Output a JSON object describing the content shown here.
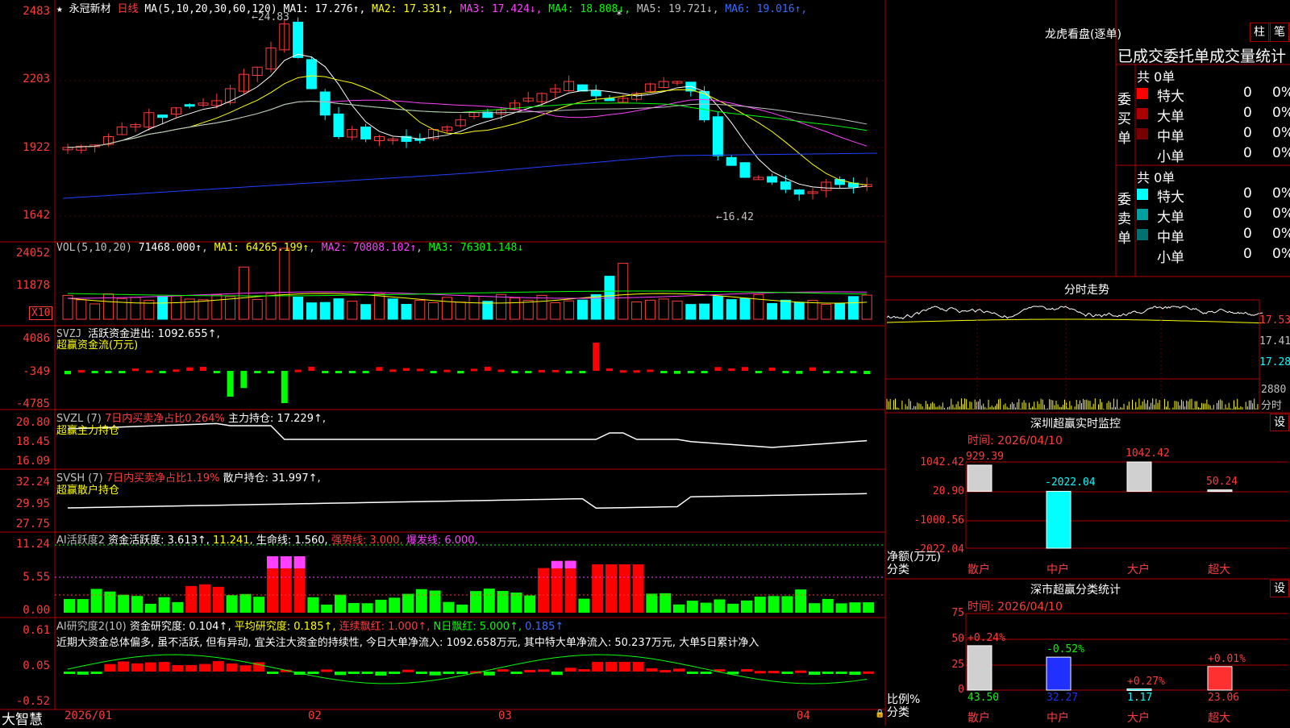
{
  "kline": {
    "star": "★",
    "stock_name": "永冠新材",
    "period": "日线",
    "ma_label": "MA(5,10,20,30,60,120)",
    "ma_values": [
      {
        "label": "MA1:",
        "value": "17.276↑",
        "color": "#ffffff"
      },
      {
        "label": "MA2:",
        "value": "17.331↑",
        "color": "#ffff00"
      },
      {
        "label": "MA3:",
        "value": "17.424↓",
        "color": "#ff40ff"
      },
      {
        "label": "MA4:",
        "value": "18.808↓",
        "color": "#00ff00"
      },
      {
        "label": "MA5:",
        "value": "19.721↓",
        "color": "#c0c0c0"
      },
      {
        "label": "MA6:",
        "value": "19.016↑",
        "color": "#3b6bff"
      }
    ],
    "y_ticks": [
      "2483",
      "2203",
      "1922",
      "1642"
    ],
    "high_label": "24.83",
    "low_label": "16.42",
    "marker": "*"
  },
  "vol": {
    "label": "VOL(5,10,20)",
    "value": "71468.000↑",
    "ma1": "MA1: 64265.199↑",
    "ma2": "MA2: 70808.102↑",
    "ma3": "MA3: 76301.148↓",
    "y_ticks": [
      "24052",
      "11878"
    ],
    "unit": "X10"
  },
  "svzj": {
    "label": "SVZJ",
    "line1": "活跃资金进出: 1092.655↑,",
    "line2": "超赢资金流(万元)",
    "y_ticks": [
      "4086",
      "-349",
      "-4785"
    ]
  },
  "svzl": {
    "label": "SVZL (7)",
    "ratio": "7日内买卖净占比0.264%",
    "hold": "主力持仓: 17.229↑,",
    "line2": "超赢主力持仓",
    "y_ticks": [
      "20.80",
      "18.45",
      "16.09"
    ]
  },
  "svsh": {
    "label": "SVSH (7)",
    "ratio": "7日内买卖净占比1.19%",
    "hold": "散户持仓: 31.997↑,",
    "line2": "超赢散户持仓",
    "y_ticks": [
      "32.24",
      "29.95",
      "27.75"
    ]
  },
  "ai1": {
    "label": "AI活跃度2",
    "fund": "资金活跃度: 3.613↑,",
    "v2": "11.241,",
    "life": "生命线: 1.560,",
    "strong": "强势线: 3.000,",
    "burst": "爆发线: 6.000,",
    "y_ticks": [
      "11.24",
      "5.55",
      "0.00"
    ]
  },
  "ai2": {
    "label": "AI研究度2(10)",
    "research": "资金研究度: 0.104↑,",
    "avg": "平均研究度: 0.185↑,",
    "cont": "连续飘红: 1.000↑,",
    "n": "N日飘红: 5.000↑,",
    "last": "0.185↑",
    "comment": "近期大资金总体偏多, 虽不活跃, 但有异动, 宜关注大资金的持续性, 今日大单净流入: 1092.658万元, 其中特大单净流入: 50.237万元, 大单5日累计净入",
    "y_ticks": [
      "0.61",
      "0.05",
      "-0.52"
    ]
  },
  "footer": {
    "brand": "大智慧",
    "dates": [
      "2026/01",
      "02",
      "03",
      "04"
    ]
  },
  "longhu": {
    "title": "龙虎看盘(逐单)",
    "btn1": "柱",
    "btn2": "笔",
    "header": "已成交委托单成交量统计",
    "buy_label": "委买单",
    "sell_label": "委卖单",
    "buy_total": "共 0单",
    "sell_total": "共 0单",
    "buy_rows": [
      {
        "name": "特大",
        "count": "0",
        "pct": "0%",
        "color": "#ff0000"
      },
      {
        "name": "大单",
        "count": "0",
        "pct": "0%",
        "color": "#aa0000"
      },
      {
        "name": "中单",
        "count": "0",
        "pct": "0%",
        "color": "#770000"
      },
      {
        "name": "小单",
        "count": "0",
        "pct": "0%",
        "color": "#000000"
      }
    ],
    "sell_rows": [
      {
        "name": "特大",
        "count": "0",
        "pct": "0%",
        "color": "#00ffff"
      },
      {
        "name": "大单",
        "count": "0",
        "pct": "0%",
        "color": "#00a0a0"
      },
      {
        "name": "中单",
        "count": "0",
        "pct": "0%",
        "color": "#007070"
      },
      {
        "name": "小单",
        "count": "0",
        "pct": "0%",
        "color": "#000000"
      }
    ]
  },
  "fenshi": {
    "title": "分时走势",
    "y_ticks": [
      "17.53",
      "17.41",
      "17.28",
      "2880"
    ],
    "unit": "分时"
  },
  "sz_monitor": {
    "title": "深圳超赢实时监控",
    "btn": "设",
    "time": "时间: 2026/04/10",
    "y_ticks": [
      "1042.42",
      "20.90",
      "-1000.56",
      "-2022.04"
    ],
    "y_label": "净额(万元)",
    "cat_label": "分类",
    "categories": [
      "散户",
      "中户",
      "大户",
      "超大"
    ],
    "values": [
      929.39,
      -2022.04,
      1042.42,
      50.24
    ],
    "value_labels": [
      "929.39",
      "-2022.04",
      "1042.42",
      "50.24"
    ]
  },
  "sz_class": {
    "title": "深市超赢分类统计",
    "btn": "设",
    "time": "时间: 2026/04/10",
    "y_ticks": [
      "75",
      "50",
      "25",
      "0"
    ],
    "y_label": "比例%",
    "cat_label": "分类",
    "categories": [
      "散户",
      "中户",
      "大户",
      "超大"
    ],
    "values": [
      43.5,
      32.27,
      1.17,
      23.06
    ],
    "changes": [
      "+0.24%",
      "-0.52%",
      "+0.27%",
      "+0.01%"
    ],
    "value_labels": [
      "43.50",
      "32.27",
      "1.17",
      "23.06"
    ]
  }
}
